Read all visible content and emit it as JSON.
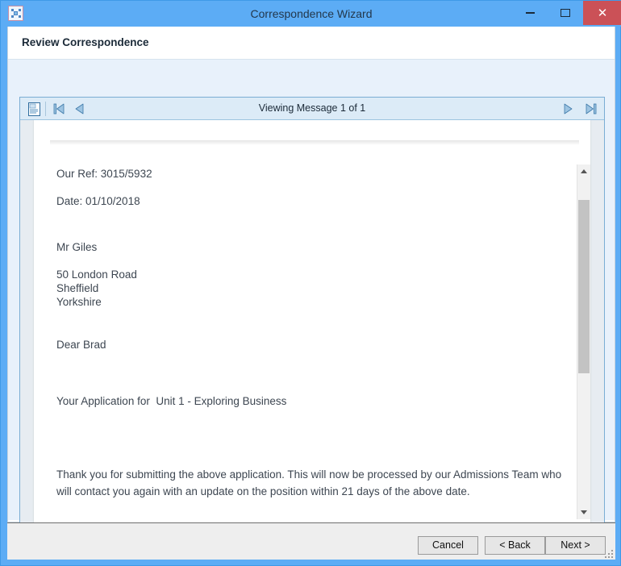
{
  "window": {
    "title": "Correspondence Wizard",
    "icon": "wizard-app-icon",
    "controls": {
      "minimize": "–",
      "maximize": "□",
      "close": "✕"
    },
    "colors": {
      "titlebar": "#5cacf5",
      "close_button": "#cb5157",
      "content_pane": "#e8f1fb",
      "toolbar": "#dcebf7",
      "viewer_border": "#7aadd4"
    }
  },
  "page": {
    "title": "Review Correspondence"
  },
  "toolbar": {
    "status": "Viewing Message 1 of 1",
    "buttons": [
      {
        "name": "document-icon",
        "label": "Document"
      },
      {
        "name": "first-message-icon",
        "label": "First"
      },
      {
        "name": "previous-message-icon",
        "label": "Previous"
      },
      {
        "name": "next-message-icon",
        "label": "Next"
      },
      {
        "name": "last-message-icon",
        "label": "Last"
      }
    ]
  },
  "document": {
    "our_ref_label": "Our Ref: 3015/5932",
    "date_label": "Date: 01/10/2018",
    "recipient_name": "Mr Giles",
    "address_line_1": "50 London Road",
    "address_line_2": "Sheffield",
    "address_line_3": "Yorkshire",
    "salutation": "Dear Brad",
    "subject": "Your Application for  Unit 1 - Exploring Business",
    "body_paragraph": "Thank you for submitting the above application. This will now be processed by our Admissions Team who will contact you again with an update on the position within 21 days of the above date."
  },
  "scrollbar": {
    "up_arrow": "▲",
    "down_arrow": "▼"
  },
  "footer": {
    "cancel_label": "Cancel",
    "back_label": "< Back",
    "next_label": "Next >"
  }
}
